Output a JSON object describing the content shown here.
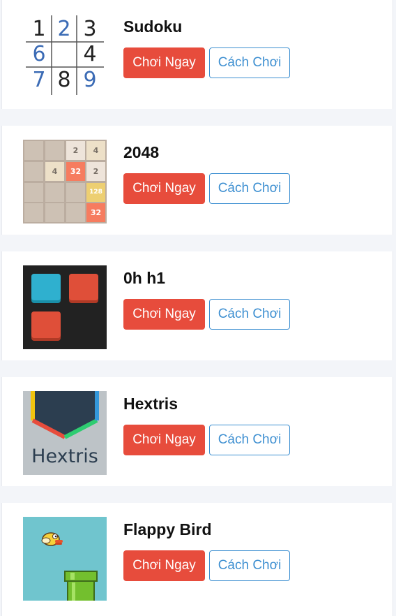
{
  "games": [
    {
      "title": "Sudoku",
      "play_label": "Chơi Ngay",
      "how_label": "Cách Chơi"
    },
    {
      "title": "2048",
      "play_label": "Chơi Ngay",
      "how_label": "Cách Chơi"
    },
    {
      "title": "0h h1",
      "play_label": "Chơi Ngay",
      "how_label": "Cách Chơi"
    },
    {
      "title": "Hextris",
      "play_label": "Chơi Ngay",
      "how_label": "Cách Chơi"
    },
    {
      "title": "Flappy Bird",
      "play_label": "Chơi Ngay",
      "how_label": "Cách Chơi"
    }
  ],
  "thumbs": {
    "sudoku_digits": [
      {
        "d": "1",
        "c": "#222222"
      },
      {
        "d": "2",
        "c": "#3b6bb5"
      },
      {
        "d": "3",
        "c": "#222222"
      },
      {
        "d": "6",
        "c": "#3b6bb5"
      },
      {
        "d": "",
        "c": "#222222"
      },
      {
        "d": "4",
        "c": "#222222"
      },
      {
        "d": "7",
        "c": "#3b6bb5"
      },
      {
        "d": "8",
        "c": "#222222"
      },
      {
        "d": "9",
        "c": "#3b6bb5"
      }
    ],
    "tiles_2048": [
      "",
      "",
      "2",
      "4",
      "",
      "4",
      "32",
      "2",
      "",
      "",
      "",
      "128",
      "",
      "",
      "",
      "32"
    ],
    "hextris_logo": "Hextris"
  },
  "colors": {
    "play_button": "#e74c3c",
    "how_button": "#3d8fd1"
  }
}
